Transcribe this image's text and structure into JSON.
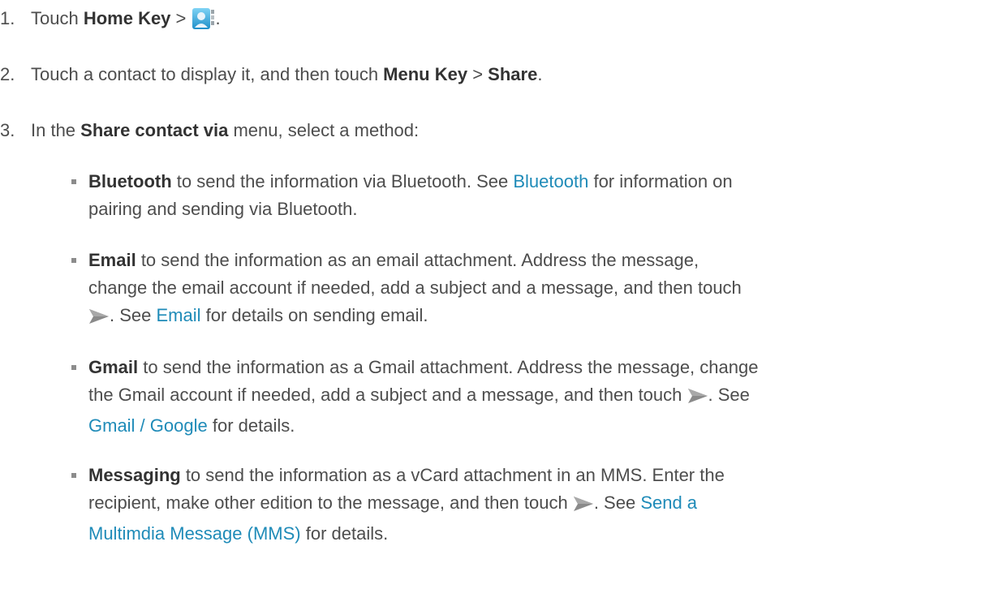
{
  "step1": {
    "num": "1.",
    "pre": "Touch ",
    "b1": "Home Key",
    "sep": " > ",
    "end": ".",
    "icon": "contacts-app-icon"
  },
  "step2": {
    "num": "2.",
    "pre": "Touch a contact to display it, and then touch ",
    "b1": "Menu Key",
    "sep": " > ",
    "b2": "Share",
    "end": "."
  },
  "step3": {
    "num": "3.",
    "pre": "In the ",
    "b1": "Share contact via",
    "post": " menu, select a method:"
  },
  "bluetooth": {
    "title": "Bluetooth",
    "l1": " to send the information via Bluetooth. See ",
    "link": "Bluetooth",
    "l1b": " for information on",
    "l2": "pairing and sending via Bluetooth."
  },
  "email": {
    "title": "Email",
    "l1": " to send the information as an email attachment. Address the message,",
    "l2": "change the email account if needed, add a subject and a message, and then touch",
    "l3a": ". See ",
    "link": "Email",
    "l3b": " for details on sending email.",
    "icon": "send-icon"
  },
  "gmail": {
    "title": "Gmail",
    "l1": " to send the information as a Gmail attachment. Address the message, change",
    "l2a": "the Gmail account if needed, add a subject and a message, and then touch ",
    "l2b": ". See",
    "link": "Gmail / Google",
    "l3b": " for details.",
    "icon": "send-icon"
  },
  "messaging": {
    "title": "Messaging",
    "l1": " to send the information as a vCard attachment in an MMS. Enter the",
    "l2a": "recipient, make other edition to the message, and then touch ",
    "l2b": ". See ",
    "link1": "Send a",
    "link2": "Multimdia Message (MMS)",
    "l3b": " for details.",
    "icon": "send-icon"
  }
}
